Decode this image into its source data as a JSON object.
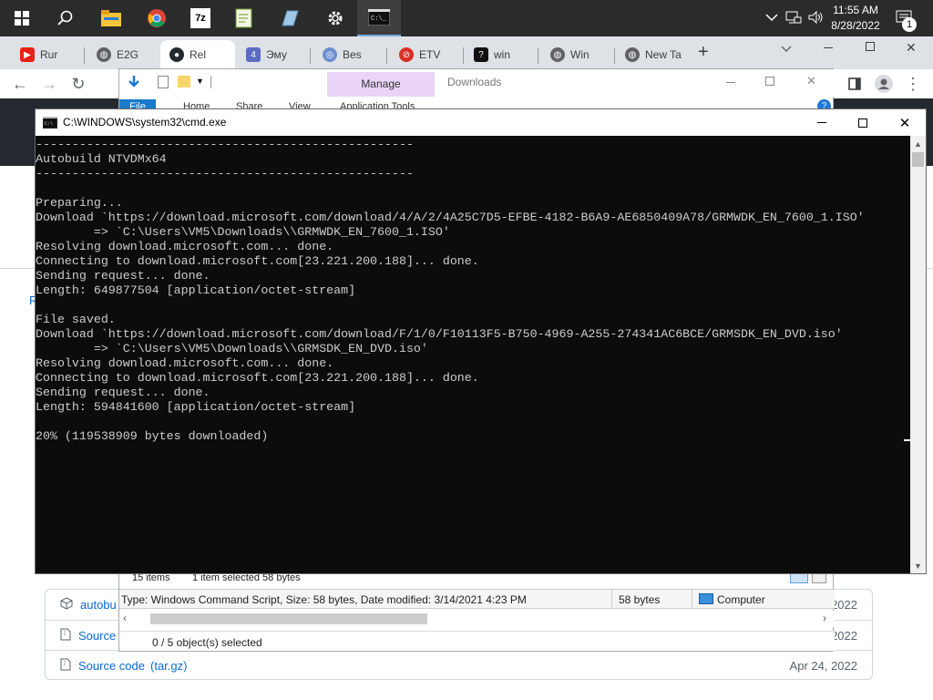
{
  "taskbar": {
    "time": "11:55 AM",
    "date": "8/28/2022",
    "notification_count": "1",
    "icons": [
      "windows-start-icon",
      "search-icon",
      "file-explorer-icon",
      "chrome-icon",
      "7zip-icon",
      "notepad-plus-icon",
      "app-icon",
      "settings-gear-icon",
      "cmd-icon"
    ]
  },
  "chrome": {
    "tabs": [
      {
        "label": "Rur",
        "icon": "youtube-icon"
      },
      {
        "label": "E2G",
        "icon": "globe-icon"
      },
      {
        "label": "Rel",
        "icon": "github-icon"
      },
      {
        "label": "Эму",
        "icon": "app-icon"
      },
      {
        "label": "Bes",
        "icon": "app-icon"
      },
      {
        "label": "ETV",
        "icon": "app-icon"
      },
      {
        "label": "win",
        "icon": "help-icon"
      },
      {
        "label": "Win",
        "icon": "globe-icon"
      },
      {
        "label": "New Ta",
        "icon": "globe-icon"
      }
    ],
    "new_tab_symbol": "+"
  },
  "explorer": {
    "title": "Downloads",
    "manage_label": "Manage",
    "tabs": [
      "File",
      "Home",
      "Share",
      "View",
      "Application Tools"
    ],
    "items_count": "15 items",
    "selected_info": "1 item selected  58 bytes",
    "details_text": "Type: Windows Command Script, Size: 58 bytes, Date modified: 3/14/2021 4:23 PM",
    "details_size": "58 bytes",
    "details_location": "Computer",
    "status_selected": "0 / 5 object(s) selected"
  },
  "github": {
    "assets": [
      {
        "label": "autobu",
        "date": "2022",
        "icon": "package-icon"
      },
      {
        "label": "Source code",
        "suffix": "",
        "date": "2022",
        "icon": "file-zip-icon"
      },
      {
        "label": "Source code",
        "suffix": "(tar.gz)",
        "date": "Apr 24, 2022",
        "icon": "file-zip-icon"
      }
    ],
    "side_letter": "R"
  },
  "cmd": {
    "title": "C:\\WINDOWS\\system32\\cmd.exe",
    "output": "----------------------------------------------------\nAutobuild NTVDMx64\n----------------------------------------------------\n\nPreparing...\nDownload `https://download.microsoft.com/download/4/A/2/4A25C7D5-EFBE-4182-B6A9-AE6850409A78/GRMWDK_EN_7600_1.ISO'\n        => `C:\\Users\\VM5\\Downloads\\\\GRMWDK_EN_7600_1.ISO'\nResolving download.microsoft.com... done.\nConnecting to download.microsoft.com[23.221.200.188]... done.\nSending request... done.\nLength: 649877504 [application/octet-stream]\n\nFile saved.\nDownload `https://download.microsoft.com/download/F/1/0/F10113F5-B750-4969-A255-274341AC6BCE/GRMSDK_EN_DVD.iso'\n        => `C:\\Users\\VM5\\Downloads\\\\GRMSDK_EN_DVD.iso'\nResolving download.microsoft.com... done.\nConnecting to download.microsoft.com[23.221.200.188]... done.\nSending request... done.\nLength: 594841600 [application/octet-stream]\n\n20% (119538909 bytes downloaded)"
  }
}
